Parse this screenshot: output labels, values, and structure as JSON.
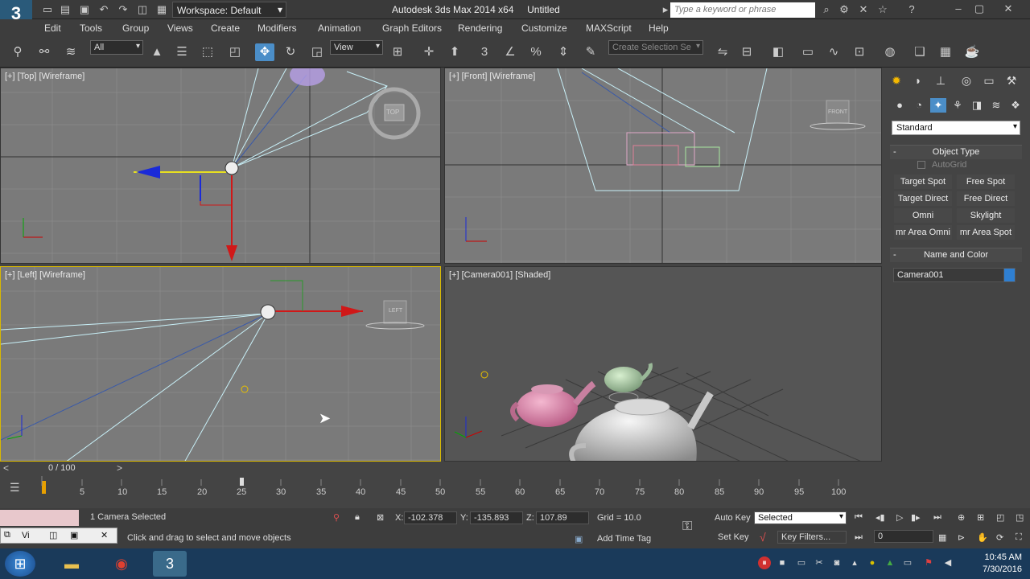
{
  "titlebar": {
    "workspace": "Workspace: Default",
    "app_title": "Autodesk 3ds Max 2014 x64",
    "file_title": "Untitled",
    "search_placeholder": "Type a keyword or phrase"
  },
  "menubar": {
    "items": [
      "Edit",
      "Tools",
      "Group",
      "Views",
      "Create",
      "Modifiers",
      "Animation",
      "Graph Editors",
      "Rendering",
      "Customize",
      "MAXScript",
      "Help"
    ]
  },
  "toolbar": {
    "selection_filter": "All",
    "reference_coord": "View",
    "named_selection_placeholder": "Create Selection Se",
    "snap_label": "3"
  },
  "viewports": {
    "top": "[+] [Top] [Wireframe]",
    "front": "[+] [Front] [Wireframe]",
    "left": "[+] [Left] [Wireframe]",
    "camera": "[+] [Camera001] [Shaded]",
    "cube_top": "TOP",
    "cube_front": "FRONT",
    "cube_left": "LEFT",
    "axis_z": "z"
  },
  "command_panel": {
    "category": "Standard",
    "object_type_title": "Object Type",
    "autogrid": "AutoGrid",
    "buttons": [
      "Target Spot",
      "Free Spot",
      "Target Direct",
      "Free Direct",
      "Omni",
      "Skylight",
      "mr Area Omni",
      "mr Area Spot"
    ],
    "name_color_title": "Name and Color",
    "object_name": "Camera001",
    "object_color": "#2f7fd1"
  },
  "timeslider": {
    "label": "0 / 100"
  },
  "timeline": {
    "ticks": [
      "5",
      "10",
      "15",
      "20",
      "25",
      "30",
      "35",
      "40",
      "45",
      "50",
      "55",
      "60",
      "65",
      "70",
      "75",
      "80",
      "85",
      "90",
      "95",
      "100"
    ]
  },
  "statusbar": {
    "selection_text": "1 Camera Selected",
    "prompt": "Click and drag to select and move objects",
    "x_label": "X:",
    "x_value": "-102.378",
    "y_label": "Y:",
    "y_value": "-135.893",
    "z_label": "Z:",
    "z_value": "107.89",
    "grid": "Grid = 10.0",
    "auto_key": "Auto Key",
    "selected": "Selected",
    "set_key": "Set Key",
    "key_filters": "Key Filters...",
    "add_time_tag": "Add Time Tag",
    "frame": "0",
    "mini_listener": "Vi"
  },
  "taskbar": {
    "time": "10:45 AM",
    "date": "7/30/2016"
  }
}
